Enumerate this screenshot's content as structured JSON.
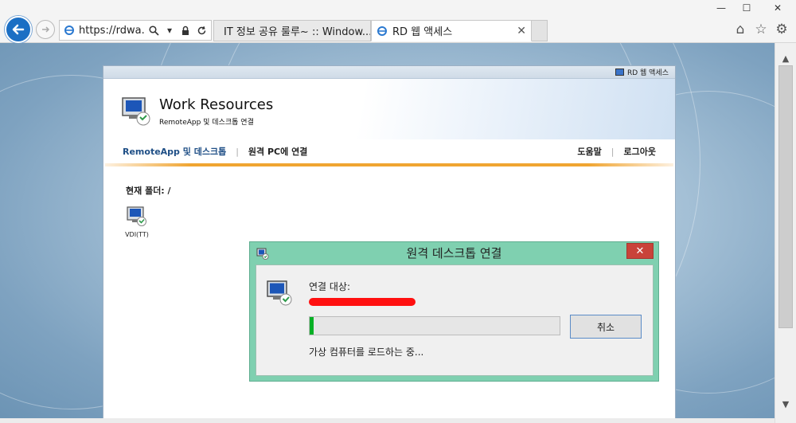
{
  "browser": {
    "url": "https://rdwa.m",
    "tabs": [
      {
        "label": "IT 정보 공유 룰루~ :: Window...",
        "active": false
      },
      {
        "label": "RD 웹 액세스",
        "active": true
      }
    ],
    "window_controls": {
      "minimize": "—",
      "maximize": "☐",
      "close": "✕"
    },
    "icons": [
      "home-icon",
      "star-icon",
      "gear-icon"
    ]
  },
  "rdweb": {
    "topbar_label": "RD 웹 액세스",
    "title": "Work Resources",
    "subtitle": "RemoteApp 및 데스크톱 연결",
    "nav": {
      "remoteapp": "RemoteApp 및 데스크톱",
      "connect_pc": "원격 PC에 연결",
      "help": "도움말",
      "logout": "로그아웃"
    },
    "current_folder": "현재 폴더: /",
    "resources": [
      {
        "label": "VDI(TT)"
      }
    ]
  },
  "dialog": {
    "title": "원격 데스크톱 연결",
    "connect_to_label": "연결 대상:",
    "progress": 0.015,
    "cancel_label": "취소",
    "status": "가상 컴퓨터를 로드하는 중...",
    "accent_color": "#7fd0b0"
  }
}
